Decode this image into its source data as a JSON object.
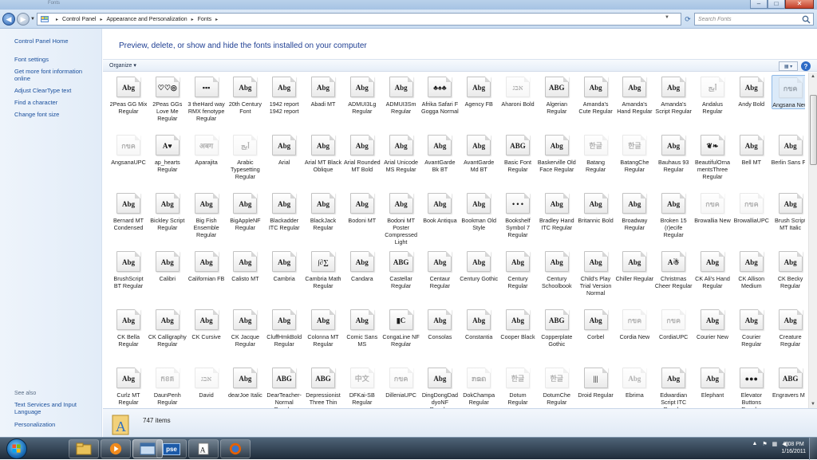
{
  "window": {
    "title": "Fonts",
    "minimize_label": "–",
    "maximize_label": "□",
    "close_label": "✕"
  },
  "address_bar": {
    "back_label": "◀",
    "forward_label": "▶",
    "breadcrumbs": [
      "Control Panel",
      "Appearance and Personalization",
      "Fonts"
    ],
    "search_placeholder": "Search Fonts"
  },
  "left_pane": {
    "links": [
      "Control Panel Home",
      "Font settings",
      "Get more font information online",
      "Adjust ClearType text",
      "Find a character",
      "Change font size"
    ],
    "see_also_title": "See also",
    "see_also_links": [
      "Text Services and Input Language",
      "Personalization"
    ]
  },
  "content": {
    "headline": "Preview, delete, or show and hide the fonts installed on your computer",
    "organize_label": "Organize",
    "help_label": "?"
  },
  "fonts": [
    {
      "name": "2Peas GG Mix Regular",
      "preview": "Abg"
    },
    {
      "name": "2Peas GGs Love Me Regular",
      "preview": "♡♡◎"
    },
    {
      "name": "3 theHard way RMX fenotype Regular",
      "preview": "▪▪▪"
    },
    {
      "name": "20th Century Font",
      "preview": "Abg"
    },
    {
      "name": "1942 report 1942 report",
      "preview": "Abg"
    },
    {
      "name": "Abadi MT",
      "preview": "Abg"
    },
    {
      "name": "ADMUI3Lg Regular",
      "preview": "Abg"
    },
    {
      "name": "ADMUI3Sm Regular",
      "preview": "Abg"
    },
    {
      "name": "Afrika Safari F Gogga Normal",
      "preview": "♣♠♣"
    },
    {
      "name": "Agency FB",
      "preview": "Abg"
    },
    {
      "name": "Aharoni Bold",
      "preview": "אבג",
      "hidden": true
    },
    {
      "name": "Algerian Regular",
      "preview": "ABG"
    },
    {
      "name": "Amanda's Cute Regular",
      "preview": "Abg"
    },
    {
      "name": "Amanda's Hand Regular",
      "preview": "Abg"
    },
    {
      "name": "Amanda's Script Regular",
      "preview": "Abg"
    },
    {
      "name": "Andalus Regular",
      "preview": "أبج",
      "hidden": true
    },
    {
      "name": "Andy Bold",
      "preview": "Abg"
    },
    {
      "name": "Angsana New",
      "preview": "กขค",
      "hidden": true,
      "selected": true
    },
    {
      "name": "AngsanaUPC",
      "preview": "กขค",
      "hidden": true
    },
    {
      "name": "ap_hearts Regular",
      "preview": "A♥"
    },
    {
      "name": "Aparajita",
      "preview": "अबग",
      "hidden": true
    },
    {
      "name": "Arabic Typesetting Regular",
      "preview": "أبج",
      "hidden": true
    },
    {
      "name": "Arial",
      "preview": "Abg"
    },
    {
      "name": "Arial MT Black Oblique",
      "preview": "Abg"
    },
    {
      "name": "Arial Rounded MT Bold",
      "preview": "Abg"
    },
    {
      "name": "Arial Unicode MS Regular",
      "preview": "Abg"
    },
    {
      "name": "AvantGarde Bk BT",
      "preview": "Abg"
    },
    {
      "name": "AvantGarde Md BT",
      "preview": "Abg"
    },
    {
      "name": "Basic Font Regular",
      "preview": "ABG"
    },
    {
      "name": "Baskerville Old Face Regular",
      "preview": "Abg"
    },
    {
      "name": "Batang Regular",
      "preview": "한글",
      "hidden": true
    },
    {
      "name": "BatangChe Regular",
      "preview": "한글",
      "hidden": true
    },
    {
      "name": "Bauhaus 93 Regular",
      "preview": "Abg"
    },
    {
      "name": "BeautifulOrnamentsThree Regular",
      "preview": "❦❧"
    },
    {
      "name": "Bell MT",
      "preview": "Abg"
    },
    {
      "name": "Berlin Sans FB",
      "preview": "Abg"
    },
    {
      "name": "Bernard MT Condensed",
      "preview": "Abg"
    },
    {
      "name": "Bickley Script Regular",
      "preview": "Abg"
    },
    {
      "name": "Big Fish Ensemble Regular",
      "preview": "Abg"
    },
    {
      "name": "BigAppleNF Regular",
      "preview": "Abg"
    },
    {
      "name": "Blackadder ITC Regular",
      "preview": "Abg"
    },
    {
      "name": "BlackJack Regular",
      "preview": "Abg"
    },
    {
      "name": "Bodoni MT",
      "preview": "Abg"
    },
    {
      "name": "Bodoni MT Poster Compressed Light",
      "preview": "Abg"
    },
    {
      "name": "Book Antiqua",
      "preview": "Abg"
    },
    {
      "name": "Bookman Old Style",
      "preview": "Abg"
    },
    {
      "name": "Bookshelf Symbol 7 Regular",
      "preview": "• • •"
    },
    {
      "name": "Bradley Hand ITC Regular",
      "preview": "Abg"
    },
    {
      "name": "Britannic Bold",
      "preview": "Abg"
    },
    {
      "name": "Broadway Regular",
      "preview": "Abg"
    },
    {
      "name": "Broken 15 (r)ecife Regular",
      "preview": "Abg"
    },
    {
      "name": "Browallia New",
      "preview": "กขค",
      "hidden": true
    },
    {
      "name": "BrowalliaUPC",
      "preview": "กขค",
      "hidden": true
    },
    {
      "name": "Brush Script MT Italic",
      "preview": "Abg"
    },
    {
      "name": "BrushScript BT Regular",
      "preview": "Abg"
    },
    {
      "name": "Calibri",
      "preview": "Abg"
    },
    {
      "name": "Californian FB",
      "preview": "Abg"
    },
    {
      "name": "Calisto MT",
      "preview": "Abg"
    },
    {
      "name": "Cambria",
      "preview": "Abg"
    },
    {
      "name": "Cambria Math Regular",
      "preview": "∫∂∑"
    },
    {
      "name": "Candara",
      "preview": "Abg"
    },
    {
      "name": "Castellar Regular",
      "preview": "ABG"
    },
    {
      "name": "Centaur Regular",
      "preview": "Abg"
    },
    {
      "name": "Century Gothic",
      "preview": "Abg"
    },
    {
      "name": "Century Regular",
      "preview": "Abg"
    },
    {
      "name": "Century Schoolbook",
      "preview": "Abg"
    },
    {
      "name": "Child's Play Trial Version Normal",
      "preview": "Abg"
    },
    {
      "name": "Chiller Regular",
      "preview": "Abg"
    },
    {
      "name": "Christmas Cheer Regular",
      "preview": "A☃"
    },
    {
      "name": "CK Ali's Hand Regular",
      "preview": "Abg"
    },
    {
      "name": "CK Allison Medium",
      "preview": "Abg"
    },
    {
      "name": "CK Becky Regular",
      "preview": "Abg"
    },
    {
      "name": "CK Bella Regular",
      "preview": "Abg"
    },
    {
      "name": "CK Calligraphy Regular",
      "preview": "Abg"
    },
    {
      "name": "CK Cursive",
      "preview": "Abg"
    },
    {
      "name": "CK Jacque Regular",
      "preview": "Abg"
    },
    {
      "name": "CluffHmkBold Regular",
      "preview": "Abg"
    },
    {
      "name": "Colonna MT Regular",
      "preview": "Abg"
    },
    {
      "name": "Comic Sans MS",
      "preview": "Abg"
    },
    {
      "name": "CongaLine NF Regular",
      "preview": "▮C"
    },
    {
      "name": "Consolas",
      "preview": "Abg"
    },
    {
      "name": "Constantia",
      "preview": "Abg"
    },
    {
      "name": "Cooper Black",
      "preview": "Abg"
    },
    {
      "name": "Copperplate Gothic",
      "preview": "ABG"
    },
    {
      "name": "Corbel",
      "preview": "Abg"
    },
    {
      "name": "Cordia New",
      "preview": "กขค",
      "hidden": true
    },
    {
      "name": "CordiaUPC",
      "preview": "กขค",
      "hidden": true
    },
    {
      "name": "Courier New",
      "preview": "Abg"
    },
    {
      "name": "Courier Regular",
      "preview": "Abg"
    },
    {
      "name": "Creature Regular",
      "preview": "Abg"
    },
    {
      "name": "Curlz MT Regular",
      "preview": "Abg"
    },
    {
      "name": "DaunPenh Regular",
      "preview": "កខគ",
      "hidden": true
    },
    {
      "name": "David",
      "preview": "אבג",
      "hidden": true
    },
    {
      "name": "dearJoe Italic",
      "preview": "Abg"
    },
    {
      "name": "DearTeacher-Normal Regular",
      "preview": "ABG"
    },
    {
      "name": "Depressionist Three Thin",
      "preview": "ABG"
    },
    {
      "name": "DFKai-SB Regular",
      "preview": "中文",
      "hidden": true
    },
    {
      "name": "DilleniaUPC",
      "preview": "กขค",
      "hidden": true
    },
    {
      "name": "DingDongDaddyoNF Regular",
      "preview": "Abg"
    },
    {
      "name": "DokChampa Regular",
      "preview": "ກຂຄ",
      "hidden": true
    },
    {
      "name": "Dotum Regular",
      "preview": "한글",
      "hidden": true
    },
    {
      "name": "DotumChe Regular",
      "preview": "한글",
      "hidden": true
    },
    {
      "name": "Droid Regular",
      "preview": "|||"
    },
    {
      "name": "Ebrima",
      "preview": "Abg",
      "hidden": true
    },
    {
      "name": "Edwardian Script ITC Regular",
      "preview": "Abg"
    },
    {
      "name": "Elephant",
      "preview": "Abg"
    },
    {
      "name": "Elevator Buttons Regular",
      "preview": "●●●"
    },
    {
      "name": "Engravers MT",
      "preview": "ABG"
    }
  ],
  "status": {
    "item_count": "747 items"
  },
  "taskbar": {
    "pse_label": "pse",
    "time": "6:08 PM",
    "date": "1/16/2011"
  }
}
